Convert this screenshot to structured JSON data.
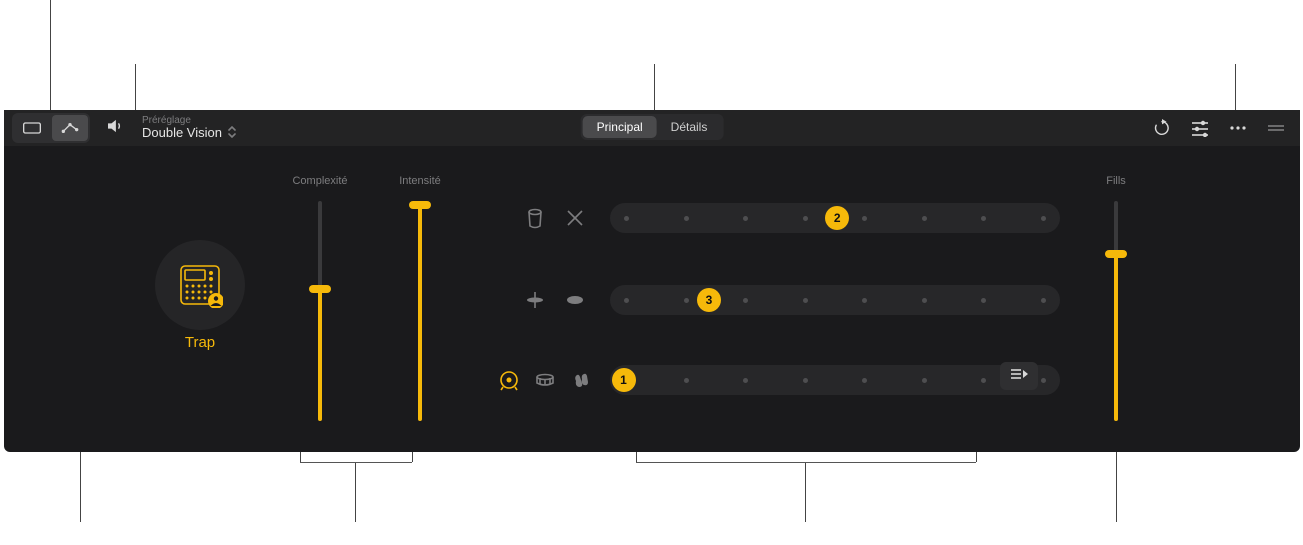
{
  "accent_color": "#f6b90a",
  "topbar": {
    "view_mode": {
      "selected_index": 1,
      "options": [
        "region-view",
        "automation-view"
      ]
    },
    "preset_label": "Préréglage",
    "preset_name": "Double Vision"
  },
  "tabs": {
    "principal": "Principal",
    "details": "Détails",
    "selected": "principal"
  },
  "style": {
    "name": "Trap"
  },
  "sliders": {
    "complexity": {
      "label": "Complexité",
      "value_pct": 60
    },
    "intensity": {
      "label": "Intensité",
      "value_pct": 98
    },
    "fills": {
      "label": "Fills",
      "value_pct": 76
    }
  },
  "rows": {
    "row1": {
      "icons": [
        "conga-icon",
        "sticks-icon"
      ],
      "steps": 8,
      "knob_step": 4,
      "knob_label": "2"
    },
    "row2": {
      "icons": [
        "hihat-icon",
        "shaker-icon"
      ],
      "steps": 8,
      "knob_step": 2,
      "knob_label": "3"
    },
    "row3": {
      "icons": [
        "kick-icon",
        "snare-icon",
        "clap-icon"
      ],
      "active_icon_index": 0,
      "steps": 8,
      "knob_step": 0,
      "knob_label": "1"
    }
  }
}
